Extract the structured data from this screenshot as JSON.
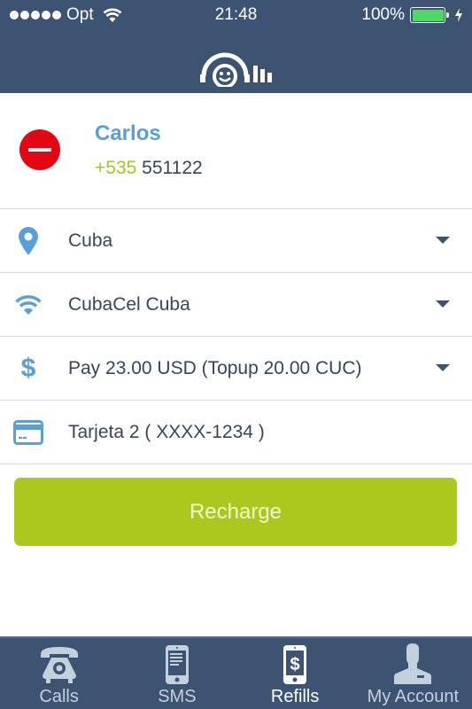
{
  "status_bar": {
    "signal_dots": 5,
    "carrier": "Opt",
    "time": "21:48",
    "battery_percent_label": "100%",
    "battery_level": 1.0,
    "charging": true
  },
  "header": {
    "logo_icon": "smiley-headphones-logo-icon"
  },
  "contact": {
    "name": "Carlos",
    "country_code": "+535",
    "number": "551122",
    "remove_icon": "remove-circle-icon"
  },
  "form": {
    "country": {
      "icon": "location-pin-icon",
      "value": "Cuba"
    },
    "operator": {
      "icon": "wifi-icon",
      "value": "CubaCel Cuba"
    },
    "amount": {
      "icon": "dollar-icon",
      "icon_glyph": "$",
      "value": "Pay 23.00 USD (Topup 20.00 CUC)"
    },
    "card": {
      "icon": "credit-card-icon",
      "value": "Tarjeta 2 ( XXXX-1234 )"
    }
  },
  "actions": {
    "recharge_label": "Recharge"
  },
  "tabbar": {
    "tabs": [
      {
        "label": "Calls",
        "icon": "phone-icon",
        "active": false
      },
      {
        "label": "SMS",
        "icon": "sms-phone-icon",
        "active": false
      },
      {
        "label": "Refills",
        "icon": "refill-phone-icon",
        "active": true
      },
      {
        "label": "My Account",
        "icon": "account-icon",
        "active": false
      }
    ]
  },
  "colors": {
    "header_bg": "#3c5372",
    "accent_green": "#acc81e",
    "accent_blue": "#5a9fd8",
    "remove_red": "#e30613",
    "text_dark": "#34465c"
  }
}
